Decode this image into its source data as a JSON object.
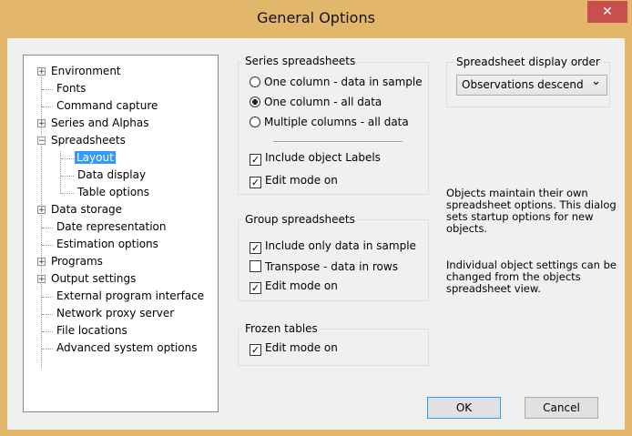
{
  "window": {
    "title": "General Options",
    "close_glyph": "✕"
  },
  "tree": {
    "items": [
      {
        "label": "Environment",
        "expandable": true,
        "expand_glyph": "+"
      },
      {
        "label": "Fonts"
      },
      {
        "label": "Command capture"
      },
      {
        "label": "Series and Alphas",
        "expandable": true,
        "expand_glyph": "+"
      },
      {
        "label": "Spreadsheets",
        "expandable": true,
        "expand_glyph": "−"
      },
      {
        "label": "Layout",
        "selected": true
      },
      {
        "label": "Data display"
      },
      {
        "label": "Table options"
      },
      {
        "label": "Data storage",
        "expandable": true,
        "expand_glyph": "+"
      },
      {
        "label": "Date representation"
      },
      {
        "label": "Estimation options"
      },
      {
        "label": "Programs",
        "expandable": true,
        "expand_glyph": "+"
      },
      {
        "label": "Output settings",
        "expandable": true,
        "expand_glyph": "+"
      },
      {
        "label": "External program interface"
      },
      {
        "label": "Network proxy server"
      },
      {
        "label": "File locations"
      },
      {
        "label": "Advanced system options"
      }
    ]
  },
  "series": {
    "title": "Series spreadsheets",
    "radio1": "One column - data in sample",
    "radio2": "One column - all data",
    "radio3": "Multiple columns - all data",
    "check1": "Include object Labels",
    "check2": "Edit mode on"
  },
  "group": {
    "title": "Group spreadsheets",
    "check1": "Include only data in sample",
    "check2": "Transpose - data in rows",
    "check3": "Edit mode on"
  },
  "frozen": {
    "title": "Frozen tables",
    "check1": "Edit mode on"
  },
  "order": {
    "title": "Spreadsheet display order",
    "value": "Observations descend",
    "arrow": "⌄"
  },
  "info": {
    "para1": "Objects maintain their own spreadsheet options. This dialog sets startup options for new objects.",
    "para2": "Individual object settings can be changed from the objects spreadsheet view."
  },
  "buttons": {
    "ok": "OK",
    "cancel": "Cancel"
  },
  "colors": {
    "titlebar": "#e2b66b",
    "close": "#c7504f",
    "selection": "#3399ff",
    "dialog_bg": "#f0f0f0"
  }
}
